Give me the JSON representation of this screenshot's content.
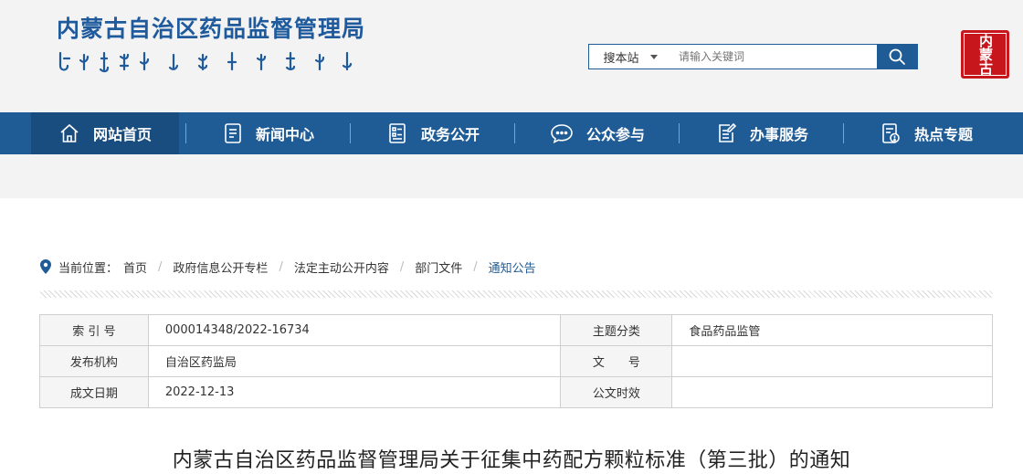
{
  "site": {
    "title": "内蒙古自治区药品监督管理局",
    "seal_text": "内蒙古"
  },
  "search": {
    "scope": "搜本站",
    "placeholder": "请输入关键词"
  },
  "nav": {
    "items": [
      {
        "label": "网站首页",
        "icon": "home-icon"
      },
      {
        "label": "新闻中心",
        "icon": "news-icon"
      },
      {
        "label": "政务公开",
        "icon": "document-list-icon"
      },
      {
        "label": "公众参与",
        "icon": "chat-icon"
      },
      {
        "label": "办事服务",
        "icon": "edit-form-icon"
      },
      {
        "label": "热点专题",
        "icon": "topic-icon"
      }
    ]
  },
  "breadcrumb": {
    "prefix": "当前位置：",
    "items": [
      "首页",
      "政府信息公开专栏",
      "法定主动公开内容",
      "部门文件",
      "通知公告"
    ]
  },
  "info_table": {
    "rows": [
      {
        "label1": "索 引 号",
        "value1": "000014348/2022-16734",
        "label2": "主题分类",
        "value2": "食品药品监管"
      },
      {
        "label1": "发布机构",
        "value1": "自治区药监局",
        "label2": "文　　号",
        "value2": ""
      },
      {
        "label1": "成文日期",
        "value1": "2022-12-13",
        "label2": "公文时效",
        "value2": ""
      }
    ]
  },
  "article": {
    "title": "内蒙古自治区药品监督管理局关于征集中药配方颗粒标准（第三批）的通知"
  },
  "colors": {
    "brand_blue": "#1f5b95",
    "nav_active": "#194c7f",
    "seal_red": "#c8161d"
  }
}
